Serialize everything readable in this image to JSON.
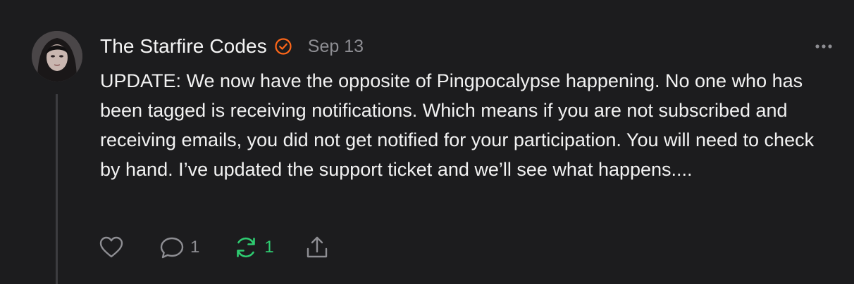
{
  "post": {
    "author": "The Starfire Codes",
    "date": "Sep 13",
    "body": "UPDATE: We now have the opposite of Pingpocalypse happening. No one who has been tagged is receiving notifications. Which means if you are not subscribed and receiving emails, you did not get notified for your participation. You will need to check by hand. I’ve updated the support ticket and we’ll see what happens...."
  },
  "actions": {
    "comments_count": "1",
    "restacks_count": "1"
  },
  "icons": {
    "verified": "verified-check-icon",
    "more": "more-options-icon",
    "like": "heart-icon",
    "comment": "comment-icon",
    "restack": "restack-icon",
    "share": "share-icon"
  },
  "colors": {
    "background": "#1c1c1e",
    "text": "#f2f2f2",
    "muted": "#8e8e93",
    "verified_orange": "#ff6719",
    "restack_green": "#2ecc71"
  }
}
